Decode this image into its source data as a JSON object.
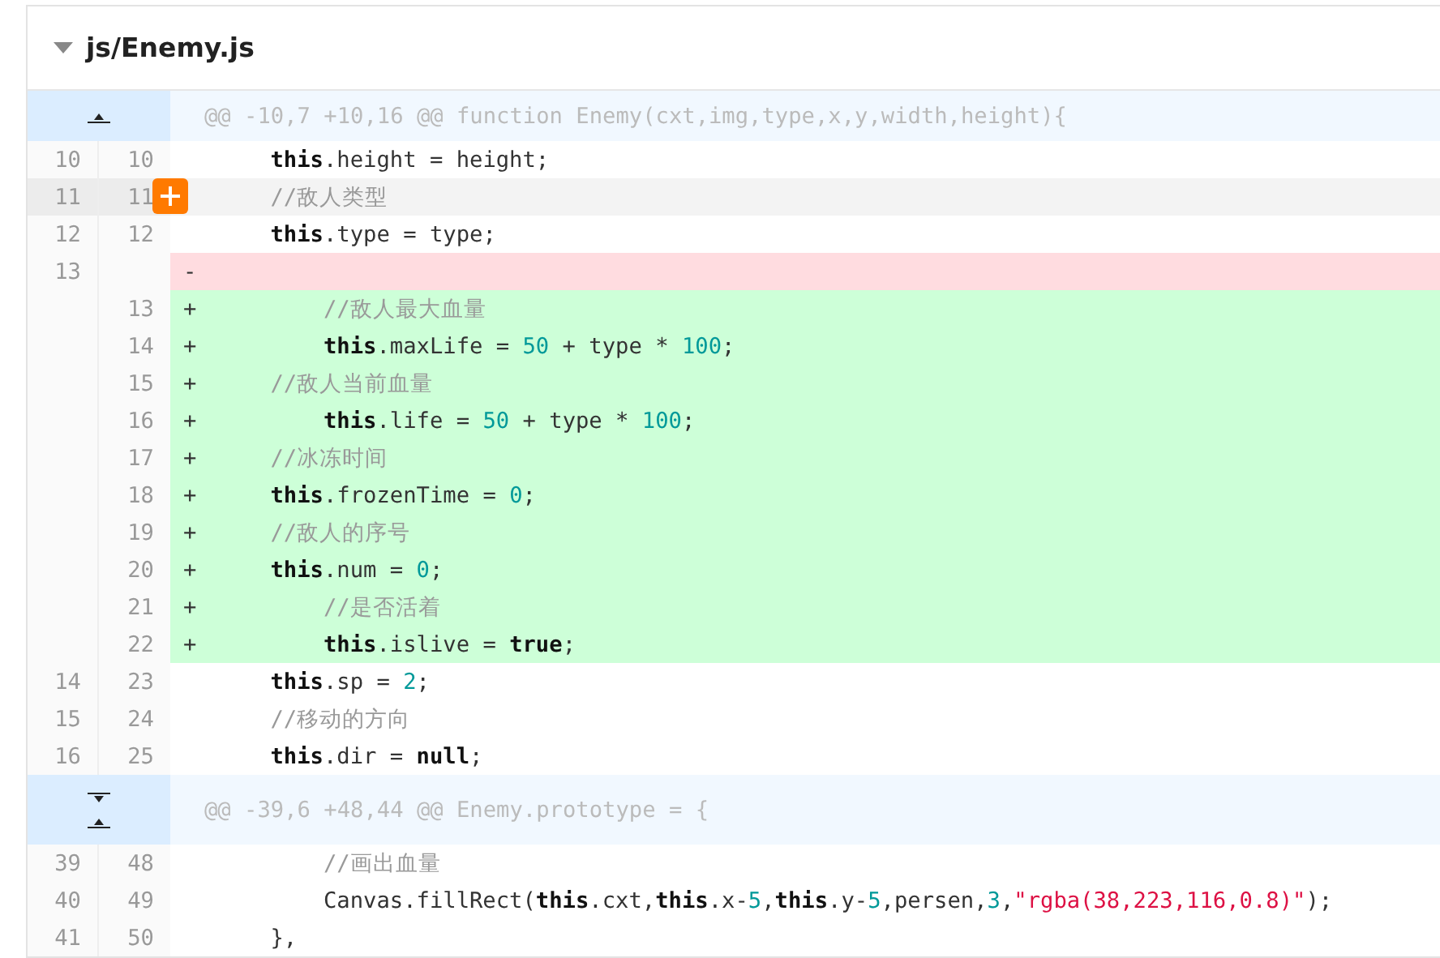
{
  "file": {
    "name": "js/Enemy.js",
    "expanded": true
  },
  "lines": [
    {
      "kind": "hunk",
      "expand": [
        {
          "kind": "up"
        }
      ],
      "text": "@@ -10,7 +10,16 @@ function Enemy(cxt,img,type,x,y,width,height){"
    },
    {
      "kind": "context",
      "old": "10",
      "new": "10",
      "hovered": false,
      "tokens": [
        {
          "kind": "keyword",
          "s": "    this"
        },
        {
          "kind": "plain",
          "s": ".height = height;"
        }
      ]
    },
    {
      "kind": "context",
      "old": "11",
      "new": "11",
      "hovered": true,
      "tokens": [
        {
          "kind": "comment",
          "s": "    //敌人类型"
        }
      ]
    },
    {
      "kind": "context",
      "old": "12",
      "new": "12",
      "hovered": false,
      "tokens": [
        {
          "kind": "keyword",
          "s": "    this"
        },
        {
          "kind": "plain",
          "s": ".type = type;"
        }
      ]
    },
    {
      "kind": "deleted",
      "old": "13",
      "marker": "-",
      "hovered": false
    },
    {
      "kind": "added",
      "new": "13",
      "marker": "+",
      "hovered": false,
      "tokens": [
        {
          "kind": "comment",
          "s": "        //敌人最大血量"
        }
      ]
    },
    {
      "kind": "added",
      "new": "14",
      "marker": "+",
      "hovered": false,
      "tokens": [
        {
          "kind": "keyword",
          "s": "        this"
        },
        {
          "kind": "plain",
          "s": ".maxLife = "
        },
        {
          "kind": "number",
          "s": "50"
        },
        {
          "kind": "plain",
          "s": " + type * "
        },
        {
          "kind": "number",
          "s": "100"
        },
        {
          "kind": "plain",
          "s": ";"
        }
      ]
    },
    {
      "kind": "added",
      "new": "15",
      "marker": "+",
      "hovered": false,
      "tokens": [
        {
          "kind": "comment",
          "s": "    //敌人当前血量"
        }
      ]
    },
    {
      "kind": "added",
      "new": "16",
      "marker": "+",
      "hovered": false,
      "tokens": [
        {
          "kind": "keyword",
          "s": "        this"
        },
        {
          "kind": "plain",
          "s": ".life = "
        },
        {
          "kind": "number",
          "s": "50"
        },
        {
          "kind": "plain",
          "s": " + type * "
        },
        {
          "kind": "number",
          "s": "100"
        },
        {
          "kind": "plain",
          "s": ";"
        }
      ]
    },
    {
      "kind": "added",
      "new": "17",
      "marker": "+",
      "hovered": false,
      "tokens": [
        {
          "kind": "comment",
          "s": "    //冰冻时间"
        }
      ]
    },
    {
      "kind": "added",
      "new": "18",
      "marker": "+",
      "hovered": false,
      "tokens": [
        {
          "kind": "keyword",
          "s": "    this"
        },
        {
          "kind": "plain",
          "s": ".frozenTime = "
        },
        {
          "kind": "number",
          "s": "0"
        },
        {
          "kind": "plain",
          "s": ";"
        }
      ]
    },
    {
      "kind": "added",
      "new": "19",
      "marker": "+",
      "hovered": false,
      "tokens": [
        {
          "kind": "comment",
          "s": "    //敌人的序号"
        }
      ]
    },
    {
      "kind": "added",
      "new": "20",
      "marker": "+",
      "hovered": false,
      "tokens": [
        {
          "kind": "keyword",
          "s": "    this"
        },
        {
          "kind": "plain",
          "s": ".num = "
        },
        {
          "kind": "number",
          "s": "0"
        },
        {
          "kind": "plain",
          "s": ";"
        }
      ]
    },
    {
      "kind": "added",
      "new": "21",
      "marker": "+",
      "hovered": false,
      "tokens": [
        {
          "kind": "comment",
          "s": "        //是否活着"
        }
      ]
    },
    {
      "kind": "added",
      "new": "22",
      "marker": "+",
      "hovered": false,
      "tokens": [
        {
          "kind": "keyword",
          "s": "        this"
        },
        {
          "kind": "plain",
          "s": ".islive = "
        },
        {
          "kind": "keyword",
          "s": "true"
        },
        {
          "kind": "plain",
          "s": ";"
        }
      ]
    },
    {
      "kind": "context",
      "old": "14",
      "new": "23",
      "hovered": false,
      "tokens": [
        {
          "kind": "keyword",
          "s": "    this"
        },
        {
          "kind": "plain",
          "s": ".sp = "
        },
        {
          "kind": "number",
          "s": "2"
        },
        {
          "kind": "plain",
          "s": ";"
        }
      ]
    },
    {
      "kind": "context",
      "old": "15",
      "new": "24",
      "hovered": false,
      "tokens": [
        {
          "kind": "comment",
          "s": "    //移动的方向"
        }
      ]
    },
    {
      "kind": "context",
      "old": "16",
      "new": "25",
      "hovered": false,
      "tokens": [
        {
          "kind": "keyword",
          "s": "    this"
        },
        {
          "kind": "plain",
          "s": ".dir = "
        },
        {
          "kind": "keyword",
          "s": "null"
        },
        {
          "kind": "plain",
          "s": ";"
        }
      ]
    },
    {
      "kind": "hunk",
      "expand": [
        {
          "kind": "down"
        },
        {
          "kind": "up"
        }
      ],
      "text": "@@ -39,6 +48,44 @@ Enemy.prototype = {"
    },
    {
      "kind": "context",
      "old": "39",
      "new": "48",
      "hovered": false,
      "tokens": [
        {
          "kind": "comment",
          "s": "        //画出血量"
        }
      ]
    },
    {
      "kind": "context",
      "old": "40",
      "new": "49",
      "hovered": false,
      "tokens": [
        {
          "kind": "plain",
          "s": "        Canvas.fillRect("
        },
        {
          "kind": "keyword",
          "s": "this"
        },
        {
          "kind": "plain",
          "s": ".cxt,"
        },
        {
          "kind": "keyword",
          "s": "this"
        },
        {
          "kind": "plain",
          "s": ".x-"
        },
        {
          "kind": "number",
          "s": "5"
        },
        {
          "kind": "plain",
          "s": ","
        },
        {
          "kind": "keyword",
          "s": "this"
        },
        {
          "kind": "plain",
          "s": ".y-"
        },
        {
          "kind": "number",
          "s": "5"
        },
        {
          "kind": "plain",
          "s": ",persen,"
        },
        {
          "kind": "number",
          "s": "3"
        },
        {
          "kind": "plain",
          "s": ","
        },
        {
          "kind": "string",
          "s": "\"rgba(38,223,116,0.8)\""
        },
        {
          "kind": "plain",
          "s": ");"
        }
      ]
    },
    {
      "kind": "context",
      "old": "41",
      "new": "50",
      "hovered": false,
      "tokens": [
        {
          "kind": "plain",
          "s": "    },"
        }
      ]
    }
  ]
}
